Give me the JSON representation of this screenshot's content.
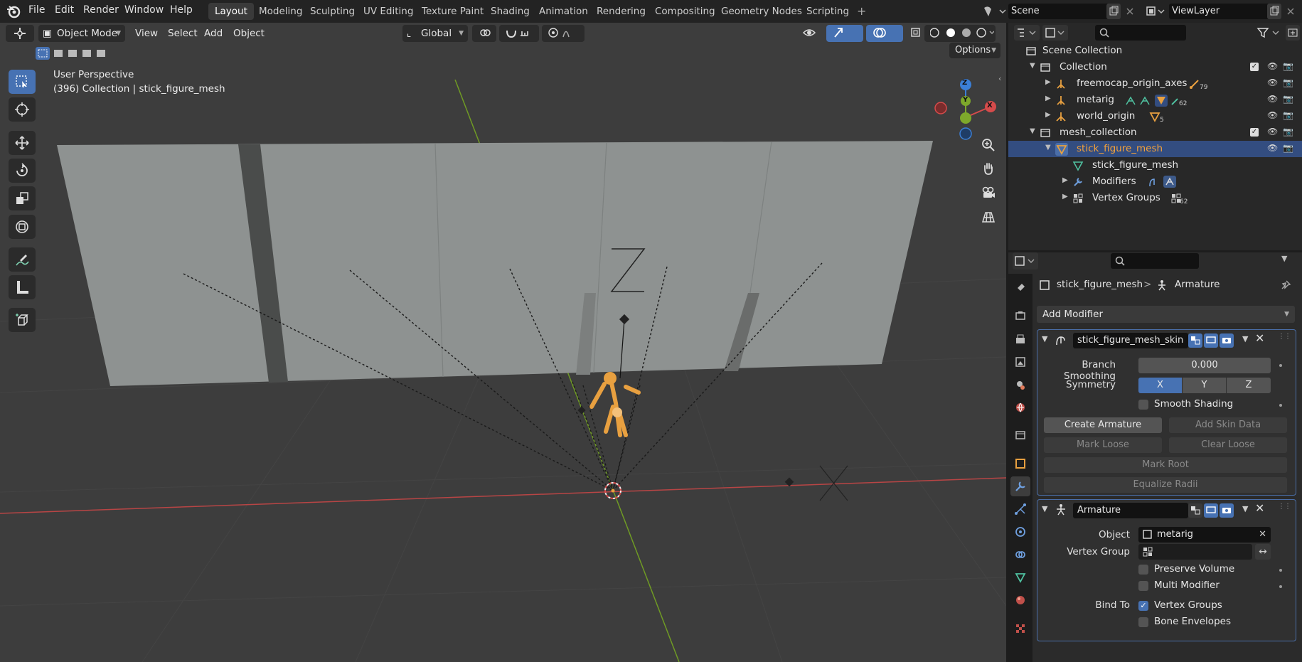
{
  "topbar": {
    "menus": [
      "File",
      "Edit",
      "Render",
      "Window",
      "Help"
    ],
    "workspaces": [
      "Layout",
      "Modeling",
      "Sculpting",
      "UV Editing",
      "Texture Paint",
      "Shading",
      "Animation",
      "Rendering",
      "Compositing",
      "Geometry Nodes",
      "Scripting"
    ],
    "active_workspace": "Layout",
    "add_workspace": "+",
    "scene": "Scene",
    "view_layer": "ViewLayer"
  },
  "viewport_header": {
    "mode": "Object Mode",
    "menus": [
      "View",
      "Select",
      "Add",
      "Object"
    ],
    "orientation": "Global",
    "options": "Options"
  },
  "viewport": {
    "perspective": "User Perspective",
    "context": "(396) Collection | stick_figure_mesh",
    "gizmo_axes": [
      "X",
      "Y",
      "Z"
    ],
    "overlay_label": "Z"
  },
  "outliner": {
    "root": "Scene Collection",
    "rows": [
      {
        "label": "Collection",
        "badge": ""
      },
      {
        "label": "freemocap_origin_axes",
        "badge": "79"
      },
      {
        "label": "metarig",
        "badge": "62"
      },
      {
        "label": "world_origin",
        "badge": "5"
      },
      {
        "label": "mesh_collection",
        "badge": ""
      },
      {
        "label": "stick_figure_mesh",
        "badge": ""
      },
      {
        "label": "stick_figure_mesh",
        "badge": ""
      },
      {
        "label": "Modifiers",
        "badge": ""
      },
      {
        "label": "Vertex Groups",
        "badge": "62"
      }
    ]
  },
  "properties": {
    "breadcrumb_object": "stick_figure_mesh",
    "breadcrumb_separator": ">",
    "breadcrumb_modifier": "Armature",
    "add_modifier": "Add Modifier",
    "skin": {
      "name": "stick_figure_mesh_skin",
      "branch_smoothing_label": "Branch Smoothing",
      "branch_smoothing_value": "0.000",
      "symmetry_label": "Symmetry",
      "symmetry": [
        "X",
        "Y",
        "Z"
      ],
      "smooth_shading": "Smooth Shading",
      "create_armature": "Create Armature",
      "add_skin_data": "Add Skin Data",
      "mark_loose": "Mark Loose",
      "clear_loose": "Clear Loose",
      "mark_root": "Mark Root",
      "equalize_radii": "Equalize Radii"
    },
    "armature": {
      "name": "Armature",
      "object_label": "Object",
      "object_value": "metarig",
      "vertex_group_label": "Vertex Group",
      "vertex_group_value": "",
      "preserve_volume": "Preserve Volume",
      "multi_modifier": "Multi Modifier",
      "bind_to_label": "Bind To",
      "vertex_groups": "Vertex Groups",
      "bone_envelopes": "Bone Envelopes",
      "vertex_groups_checked": true
    }
  },
  "colors": {
    "accent": "#4772b3",
    "selection": "#334d80",
    "object_orange": "#e8a040",
    "x_axis": "#d64b4b",
    "y_axis": "#7ea82b",
    "z_axis": "#3b7fd6"
  }
}
